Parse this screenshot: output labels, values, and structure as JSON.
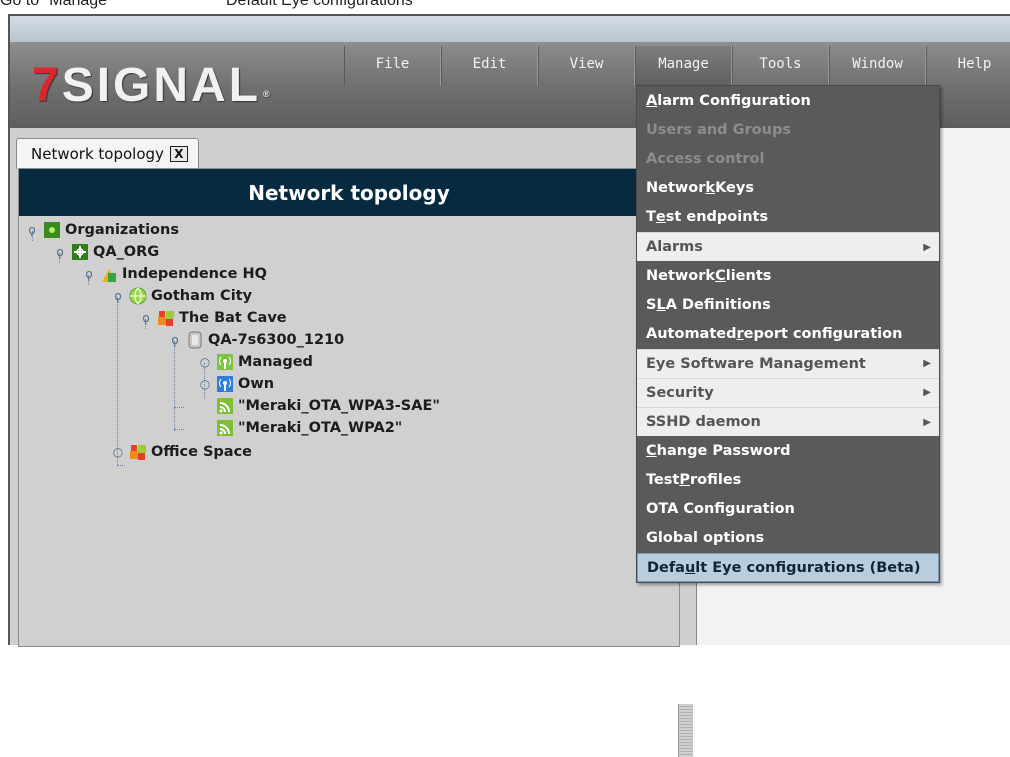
{
  "caption": {
    "step": "Go to \"Manage\"",
    "target": "Default Eye configurations"
  },
  "logo": {
    "seven": "7",
    "text": "SIGNAL",
    "reg": "®"
  },
  "menubar": [
    "File",
    "Edit",
    "View",
    "Manage",
    "Tools",
    "Window",
    "Help"
  ],
  "tab": {
    "label": "Network topology",
    "close": "X"
  },
  "panel": {
    "title": "Network topology"
  },
  "tree": [
    {
      "label": "Organizations",
      "icon": "organization-icon"
    },
    {
      "label": "QA_ORG",
      "icon": "org-gear-icon"
    },
    {
      "label": "Independence HQ",
      "icon": "building-icon"
    },
    {
      "label": "Gotham City",
      "icon": "globe-icon"
    },
    {
      "label": "The Bat Cave",
      "icon": "puzzle-icon"
    },
    {
      "label": "QA-7s6300_1210",
      "icon": "eye-sensor-icon"
    },
    {
      "label": "Managed",
      "icon": "antenna-managed-icon"
    },
    {
      "label": "Own",
      "icon": "antenna-own-icon"
    },
    {
      "label": "\"Meraki_OTA_WPA3-SAE\"",
      "icon": "wifi-network-icon"
    },
    {
      "label": "\"Meraki_OTA_WPA2\"",
      "icon": "wifi-network-icon"
    },
    {
      "label": "Office Space",
      "icon": "puzzle-icon"
    }
  ],
  "manage_menu": {
    "items": [
      {
        "pre": "",
        "ul": "A",
        "post": "larm Configuration",
        "state": "enabled"
      },
      {
        "pre": "Users and Groups",
        "ul": "",
        "post": "",
        "state": "disabled"
      },
      {
        "pre": "Access control",
        "ul": "",
        "post": "",
        "state": "disabled"
      },
      {
        "pre": "Networ",
        "ul": "k",
        "post": " Keys",
        "state": "enabled"
      },
      {
        "pre": "T",
        "ul": "e",
        "post": "st endpoints",
        "state": "enabled"
      },
      {
        "pre": "Alarms",
        "ul": "",
        "post": "",
        "state": "submenu"
      },
      {
        "pre": "Network ",
        "ul": "C",
        "post": "lients",
        "state": "enabled"
      },
      {
        "pre": "S",
        "ul": "L",
        "post": "A Definitions",
        "state": "enabled"
      },
      {
        "pre": "Automated ",
        "ul": "r",
        "post": "eport configuration",
        "state": "enabled"
      },
      {
        "pre": "Eye Software Management",
        "ul": "",
        "post": "",
        "state": "submenu"
      },
      {
        "pre": "Security",
        "ul": "",
        "post": "",
        "state": "submenu"
      },
      {
        "pre": "SSHD daemon",
        "ul": "",
        "post": "",
        "state": "submenu"
      },
      {
        "pre": "",
        "ul": "C",
        "post": "hange Password",
        "state": "enabled"
      },
      {
        "pre": "Test ",
        "ul": "P",
        "post": "rofiles",
        "state": "enabled"
      },
      {
        "pre": "OTA Configuration",
        "ul": "",
        "post": "",
        "state": "enabled"
      },
      {
        "pre": "Global options",
        "ul": "",
        "post": "",
        "state": "enabled"
      },
      {
        "pre": "Defa",
        "ul": "u",
        "post": "lt Eye configurations (Beta)",
        "state": "selected"
      }
    ],
    "arrow": "▶"
  },
  "colors": {
    "panel_header": "#062b40",
    "logo_red": "#d8282e",
    "menu_bg": "#5a5a5a",
    "menu_selected": "#b8cde0"
  }
}
